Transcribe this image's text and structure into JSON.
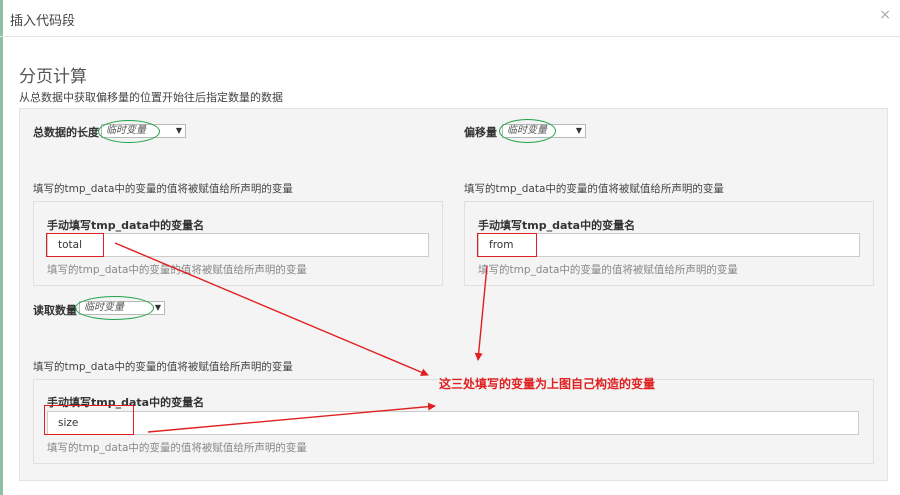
{
  "header": {
    "title": "插入代码段",
    "close": "×"
  },
  "section": {
    "title": "分页计算",
    "description": "从总数据中获取偏移量的位置开始往后指定数量的数据"
  },
  "fields": {
    "total": {
      "label": "总数据的长度",
      "select_value": "临时变量",
      "hint": "填写的tmp_data中的变量的值将被赋值给所声明的变量",
      "input_label": "手动填写tmp_data中的变量名",
      "input_value": "total",
      "help": "填写的tmp_data中的变量的值将被赋值给所声明的变量"
    },
    "offset": {
      "label": "偏移量",
      "select_value": "临时变量",
      "hint": "填写的tmp_data中的变量的值将被赋值给所声明的变量",
      "input_label": "手动填写tmp_data中的变量名",
      "input_value": "from",
      "help": "填写的tmp_data中的变量的值将被赋值给所声明的变量"
    },
    "size": {
      "label": "读取数量",
      "select_value": "临时变量",
      "hint": "填写的tmp_data中的变量的值将被赋值给所声明的变量",
      "input_label": "手动填写tmp_data中的变量名",
      "input_value": "size",
      "help": "填写的tmp_data中的变量的值将被赋值给所声明的变量"
    }
  },
  "annotation": {
    "text": "这三处填写的变量为上图自己构造的变量",
    "color": "#e02020"
  },
  "colors": {
    "highlight_green": "#22a34a",
    "highlight_red": "#e02020"
  }
}
